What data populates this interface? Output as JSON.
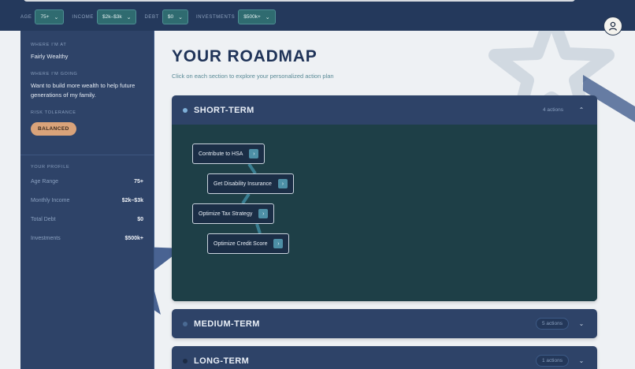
{
  "filters": [
    {
      "label": "AGE",
      "value": "75+"
    },
    {
      "label": "INCOME",
      "value": "$2k–$3k"
    },
    {
      "label": "DEBT",
      "value": "$0"
    },
    {
      "label": "INVESTMENTS",
      "value": "$500k+"
    }
  ],
  "sidebar": {
    "where_at_label": "WHERE I'M AT",
    "where_at_value": "Fairly Wealthy",
    "where_going_label": "WHERE I'M GOING",
    "where_going_value": "Want to build more wealth to help future generations of my family.",
    "risk_label": "RISK TOLERANCE",
    "risk_value": "BALANCED",
    "profile_label": "YOUR PROFILE",
    "profile": [
      {
        "key": "Age Range",
        "value": "75+"
      },
      {
        "key": "Monthly Income",
        "value": "$2k–$3k"
      },
      {
        "key": "Total Debt",
        "value": "$0"
      },
      {
        "key": "Investments",
        "value": "$500k+"
      }
    ]
  },
  "main": {
    "title": "YOUR ROADMAP",
    "subtitle": "Click on each section to explore your personalized action plan",
    "sections": [
      {
        "title": "SHORT-TERM",
        "count": "4 actions",
        "expanded": true,
        "dot_color": "#7fb0d8",
        "actions": [
          "Contribute to HSA",
          "Get Disability Insurance",
          "Optimize Tax Strategy",
          "Optimize Credit Score"
        ]
      },
      {
        "title": "MEDIUM-TERM",
        "count": "5 actions",
        "expanded": false,
        "dot_color": "#4a6a93"
      },
      {
        "title": "LONG-TERM",
        "count": "1 actions",
        "expanded": false,
        "dot_color": "#1c2c45"
      }
    ]
  },
  "icons": {
    "avatar": "user-icon",
    "chevron": "chevron-down-icon",
    "arrow": "chevron-right-icon"
  },
  "colors": {
    "topbar": "#24395c",
    "sidebar": "#2e4368",
    "accent_teal": "#2f6b70",
    "risk_badge": "#d9a37a",
    "section_body": "#1e3f47"
  }
}
